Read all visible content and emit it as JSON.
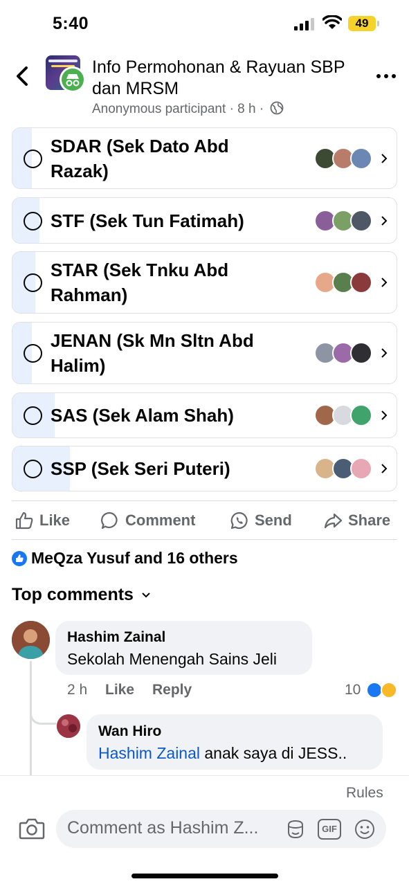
{
  "status_bar": {
    "time": "5:40",
    "battery": "49"
  },
  "header": {
    "title": "Info Permohonan & Rayuan SBP dan MRSM",
    "meta_author": "Anonymous participant",
    "meta_sep": "·",
    "meta_time": "8 h",
    "meta_sep2": "·"
  },
  "poll": {
    "options": [
      {
        "label": "SDAR (Sek Dato Abd Razak)",
        "fill_fraction": 0.05
      },
      {
        "label": "STF (Sek Tun Fatimah)",
        "fill_fraction": 0.07
      },
      {
        "label": "STAR (Sek Tnku Abd Rahman)",
        "fill_fraction": 0.06
      },
      {
        "label": "JENAN (Sk Mn Sltn Abd Halim)",
        "fill_fraction": 0.05
      },
      {
        "label": "SAS (Sek Alam Shah)",
        "fill_fraction": 0.11
      },
      {
        "label": "SSP (Sek Seri Puteri)",
        "fill_fraction": 0.15
      }
    ]
  },
  "actions": {
    "like": "Like",
    "comment": "Comment",
    "send": "Send",
    "share": "Share"
  },
  "reactions": {
    "summary": "MeQza Yusuf and 16 others"
  },
  "comments_header": "Top comments",
  "comments": [
    {
      "author": "Hashim Zainal",
      "text": "Sekolah Menengah Sains Jeli",
      "time": "2 h",
      "like": "Like",
      "reply": "Reply",
      "reaction_count": "10"
    }
  ],
  "reply": {
    "author": "Wan Hiro",
    "mention": "Hashim Zainal",
    "text": " anak saya di JESS.."
  },
  "composer": {
    "rules": "Rules",
    "placeholder": "Comment as Hashim Z...",
    "gif": "GIF"
  },
  "colors": {
    "accent": "#1877f2",
    "poll_fill": "#e7f0fc",
    "secondary_text": "#65676b"
  }
}
